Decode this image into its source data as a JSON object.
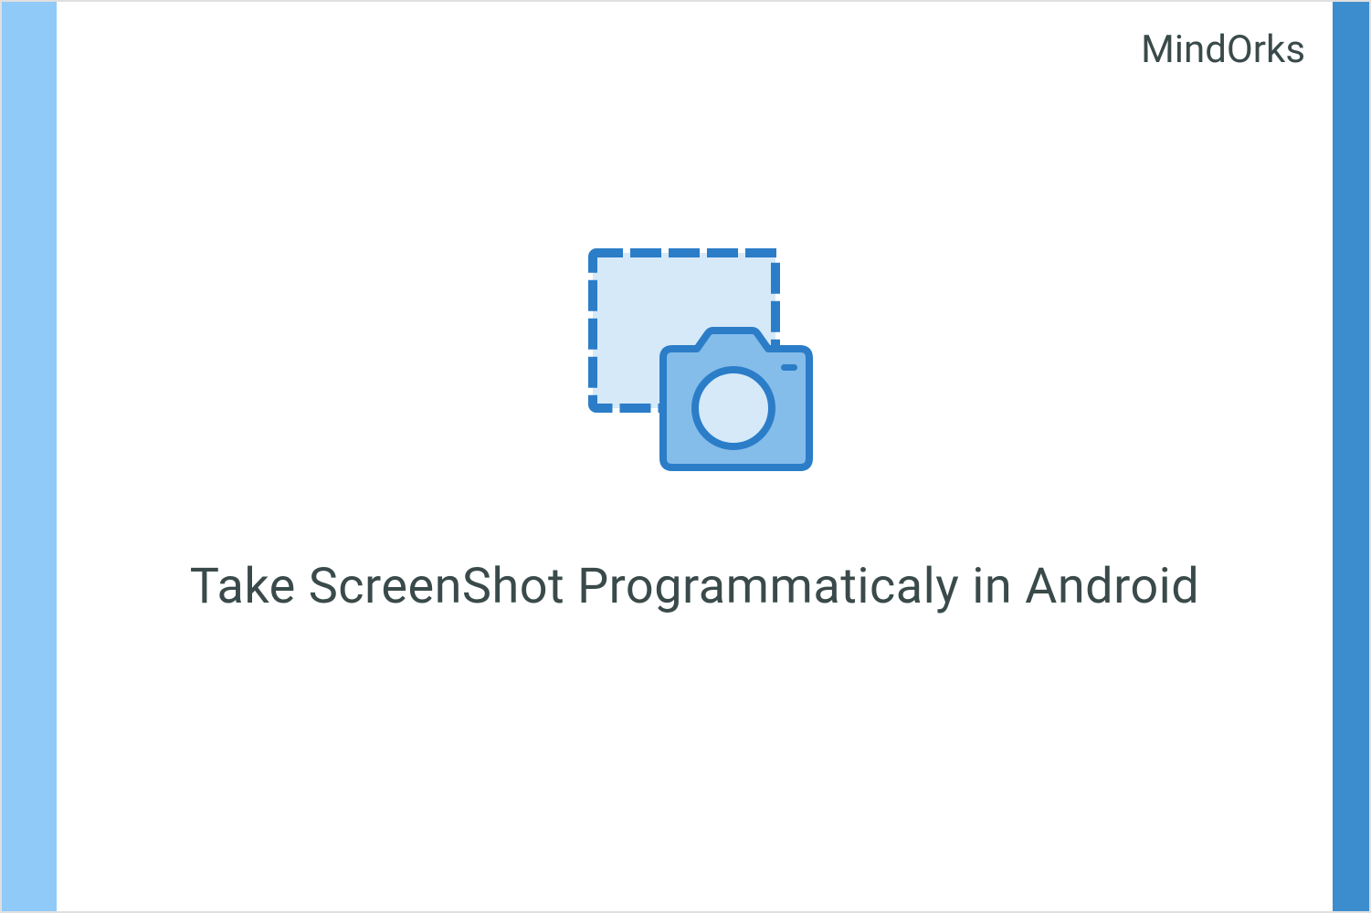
{
  "brand": "MindOrks",
  "title": "Take ScreenShot Programmaticaly in Android",
  "colors": {
    "left_bar": "#90caf9",
    "right_bar": "#3c8dce",
    "text": "#3a4a4a",
    "icon_stroke": "#2b7dc8",
    "icon_selection_fill": "#d6e9f8",
    "icon_camera_fill": "#84bcea",
    "icon_lens_fill": "#d6e9f8"
  },
  "icon_name": "screenshot-camera-icon"
}
